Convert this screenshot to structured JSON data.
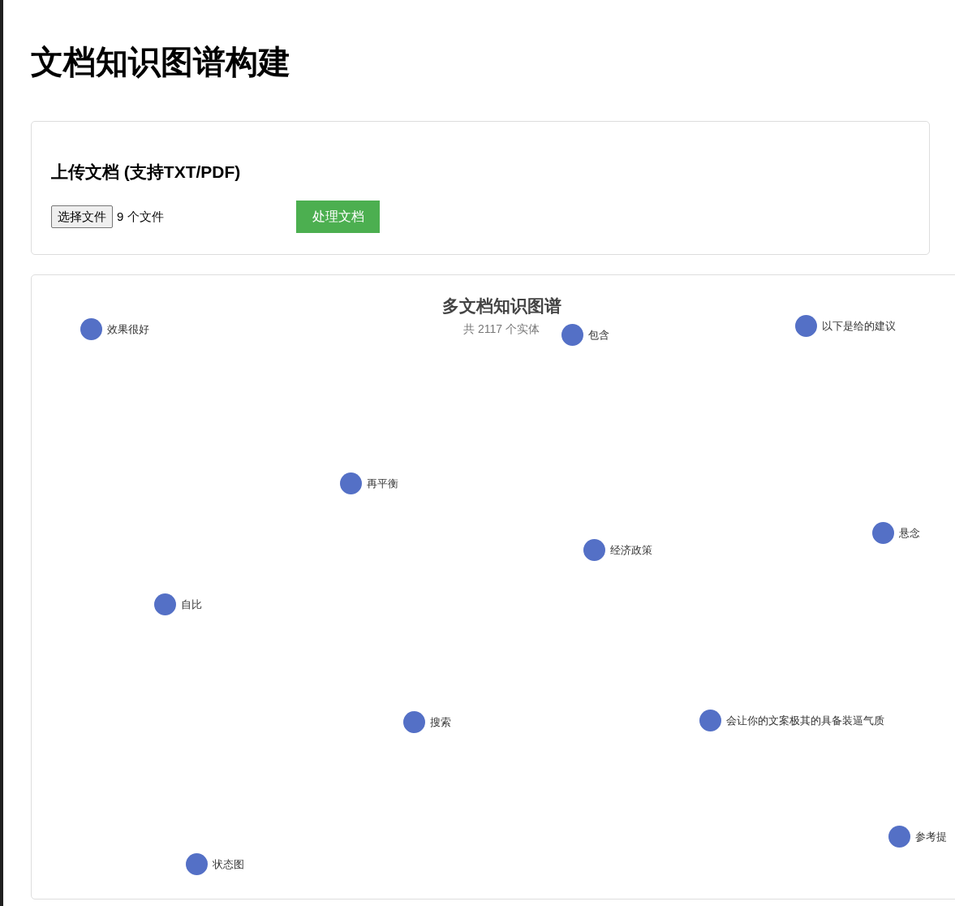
{
  "title": "文档知识图谱构建",
  "upload": {
    "heading": "上传文档 (支持TXT/PDF)",
    "file_button": "选择文件",
    "file_status": "9 个文件",
    "process_button": "处理文档"
  },
  "graph": {
    "title": "多文档知识图谱",
    "subtitle": "共 2117 个实体",
    "nodes": [
      {
        "label": "效果很好"
      },
      {
        "label": "包含"
      },
      {
        "label": "以下是给的建议"
      },
      {
        "label": "再平衡"
      },
      {
        "label": "悬念"
      },
      {
        "label": "经济政策"
      },
      {
        "label": "自比"
      },
      {
        "label": "搜索"
      },
      {
        "label": "会让你的文案极其的具备装逼气质"
      },
      {
        "label": "参考提"
      },
      {
        "label": "状态图"
      }
    ]
  }
}
